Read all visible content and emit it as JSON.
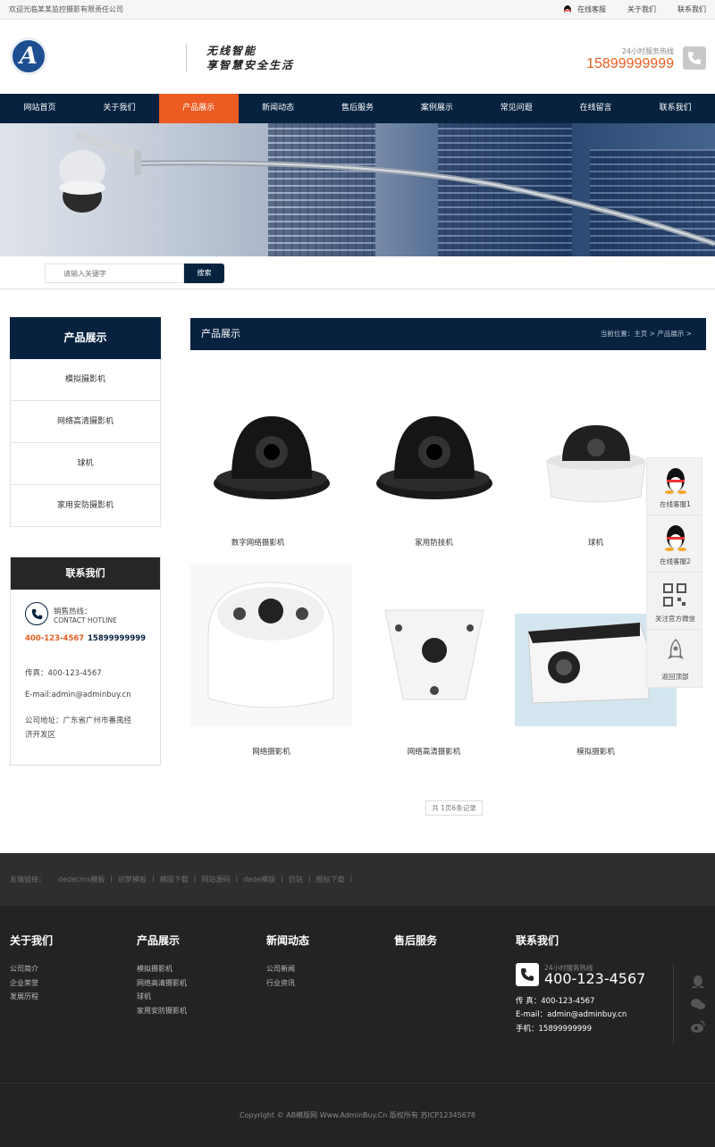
{
  "topbar": {
    "welcome": "欢迎光临某某监控摄影有限责任公司",
    "online_service": "在线客服",
    "about": "关于我们",
    "contact": "联系我们"
  },
  "header": {
    "logo_letter": "A",
    "slogan_line1": "无线智能",
    "slogan_line2": "享智慧安全生活",
    "hotline_label": "24小时服务热线",
    "hotline_number": "15899999999"
  },
  "nav": [
    {
      "label": "网站首页"
    },
    {
      "label": "关于我们"
    },
    {
      "label": "产品展示",
      "active": true
    },
    {
      "label": "新闻动态"
    },
    {
      "label": "售后服务"
    },
    {
      "label": "案例展示"
    },
    {
      "label": "常见问题"
    },
    {
      "label": "在线留言"
    },
    {
      "label": "联系我们"
    }
  ],
  "search": {
    "placeholder": "请输入关键字",
    "button": "搜索"
  },
  "sidebar": {
    "title": "产品展示",
    "items": [
      {
        "label": "模拟摄影机"
      },
      {
        "label": "网络高清摄影机"
      },
      {
        "label": "球机"
      },
      {
        "label": "家用安防摄影机"
      }
    ]
  },
  "contact_box": {
    "title": "联系我们",
    "hot_label": "销售热线：",
    "hot_en": "CONTACT HOTLINE",
    "phone1": "400-123-4567",
    "phone2": "15899999999",
    "fax": "传真：400-123-4567",
    "email": "E-mail:admin@adminbuy.cn",
    "address_l1": "公司地址：广东省广州市番禺经",
    "address_l2": "济开发区"
  },
  "main": {
    "title": "产品展示",
    "breadcrumb": "当前位置：主页 > 产品展示 >"
  },
  "products": [
    {
      "name": "数字网络摄影机"
    },
    {
      "name": "家用防技机"
    },
    {
      "name": "球机"
    },
    {
      "name": "网络摄影机"
    },
    {
      "name": "网络高清摄影机"
    },
    {
      "name": "模拟摄影机"
    }
  ],
  "pager": "共 1页6条记录",
  "float_bar": {
    "qq1": "在线客服1",
    "qq2": "在线客服2",
    "wechat": "关注官方微信",
    "top": "返回顶部"
  },
  "friend_links": {
    "label": "友情链接：",
    "items": [
      "dedecms模板",
      "织梦模板",
      "模版下载",
      "网站源码",
      "dede模版",
      "仿站",
      "图标下载"
    ]
  },
  "footer": {
    "cols": [
      {
        "title": "关于我们",
        "items": [
          "公司简介",
          "企业荣誉",
          "发展历程"
        ]
      },
      {
        "title": "产品展示",
        "items": [
          "模拟摄影机",
          "网络高清摄影机",
          "球机",
          "家用安防摄影机"
        ]
      },
      {
        "title": "新闻动态",
        "items": [
          "公司新闻",
          "行业资讯"
        ]
      },
      {
        "title": "售后服务",
        "items": []
      }
    ],
    "contact_title": "联系我们",
    "hot_label": "24小时服务热线",
    "hot_number": "400-123-4567",
    "fax": "传 真：400-123-4567",
    "email": "E-mail：admin@adminbuy.cn",
    "mobile": "手机：15899999999",
    "copyright": "Copyright © AB模版网 Www.AdminBuy.Cn 版权所有   苏ICP12345678"
  }
}
